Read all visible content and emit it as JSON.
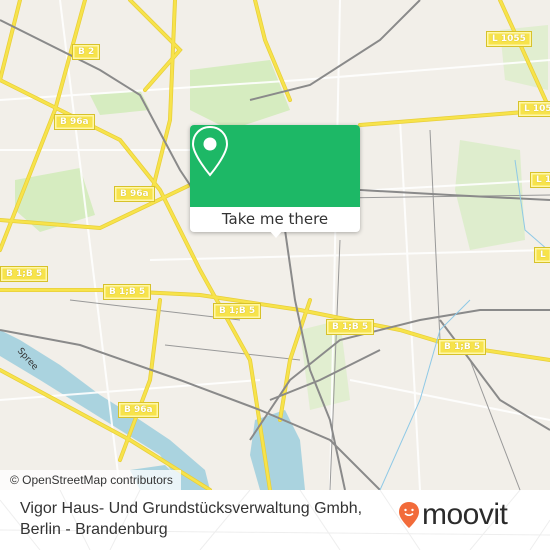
{
  "map": {
    "attribution": "© OpenStreetMap contributors",
    "river_label": "Spree",
    "road_shields": [
      {
        "label": "B 2"
      },
      {
        "label": "B 96a"
      },
      {
        "label": "B 96a"
      },
      {
        "label": "B 1;B 5"
      },
      {
        "label": "B 1;B 5"
      },
      {
        "label": "B 1;B 5"
      },
      {
        "label": "B 1;B 5"
      },
      {
        "label": "B 1;B 5"
      },
      {
        "label": "B 96a"
      },
      {
        "label": "L 1055"
      },
      {
        "label": "L 105"
      },
      {
        "label": "L 1"
      },
      {
        "label": "L"
      }
    ],
    "colors": {
      "land": "#f2efe9",
      "water": "#aad3df",
      "park": "#cdebb0",
      "major_road": "#f7e34b",
      "rail": "#888888"
    }
  },
  "popup": {
    "button_label": "Take me there",
    "icon": "map-pin-icon",
    "color": "#1db866"
  },
  "footer": {
    "place_line1": "Vigor Haus- Und Grundstücksverwaltung Gmbh,",
    "place_line2": "Berlin - Brandenburg",
    "brand": "moovit",
    "brand_color": "#f26b3a"
  }
}
